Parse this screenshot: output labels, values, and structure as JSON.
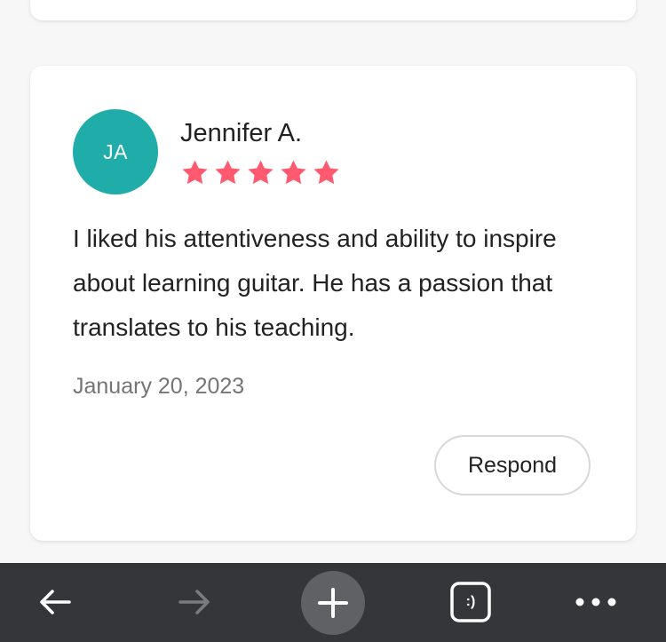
{
  "review": {
    "avatar_initials": "JA",
    "avatar_color": "#20aca8",
    "reviewer_name": "Jennifer A.",
    "rating": 5,
    "star_color": "#ff5a6f",
    "text": "I liked his attentiveness and ability to inspire about learning guitar. He has a passion that translates to his teaching.",
    "date": "January 20, 2023",
    "respond_label": "Respond"
  },
  "browser_toolbar": {
    "background": "#35363a",
    "back_icon": "arrow-left-icon",
    "forward_icon": "arrow-right-icon",
    "new_tab_icon": "plus-icon",
    "tab_switcher_label": ":)",
    "menu_icon": "more-horizontal-icon"
  }
}
